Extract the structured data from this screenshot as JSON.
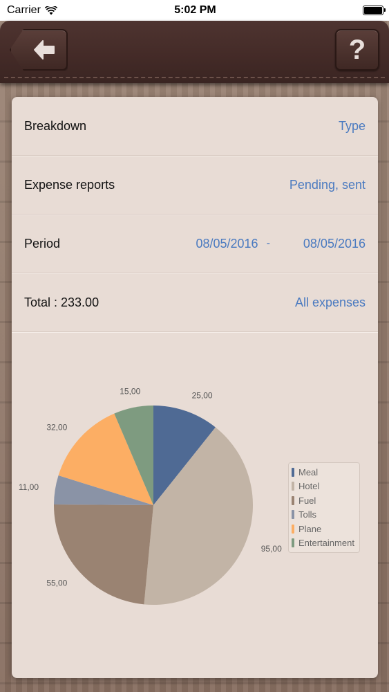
{
  "status_bar": {
    "carrier": "Carrier",
    "time": "5:02 PM"
  },
  "header": {
    "help_label": "?"
  },
  "rows": {
    "breakdown": {
      "label": "Breakdown",
      "value": "Type"
    },
    "expense_reports": {
      "label": "Expense reports",
      "value": "Pending, sent"
    },
    "period": {
      "label": "Period",
      "from": "08/05/2016",
      "separator": "-",
      "to": "08/05/2016"
    },
    "total": {
      "label": "Total : 233.00",
      "value": "All expenses"
    }
  },
  "chart_data": {
    "type": "pie",
    "slices": [
      {
        "name": "Meal",
        "value": 25,
        "label": "25,00",
        "color": "#4f6a94"
      },
      {
        "name": "Hotel",
        "value": 95,
        "label": "95,00",
        "color": "#c2b4a6"
      },
      {
        "name": "Fuel",
        "value": 55,
        "label": "55,00",
        "color": "#9a8372"
      },
      {
        "name": "Tolls",
        "value": 11,
        "label": "11,00",
        "color": "#8a93a6"
      },
      {
        "name": "Plane",
        "value": 32,
        "label": "32,00",
        "color": "#fcae64"
      },
      {
        "name": "Entertainment",
        "value": 15,
        "label": "15,00",
        "color": "#7e9b80"
      }
    ],
    "legend_position": "right"
  }
}
